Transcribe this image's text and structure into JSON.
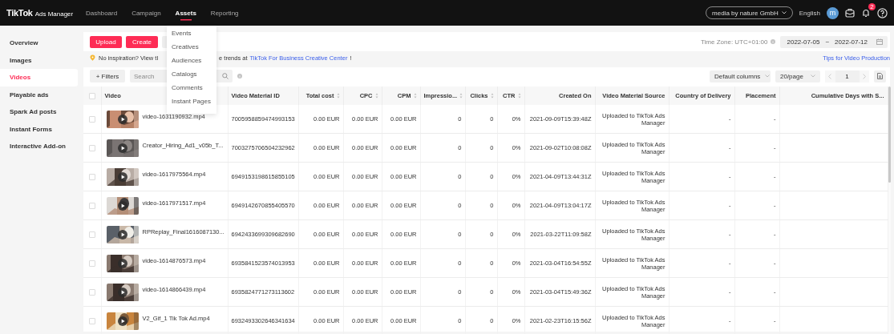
{
  "top_bar": {
    "brand": "TikTok",
    "product": "Ads Manager",
    "nav": [
      {
        "label": "Dashboard",
        "selected": false
      },
      {
        "label": "Campaign",
        "selected": false
      },
      {
        "label": "Assets",
        "selected": true
      },
      {
        "label": "Reporting",
        "selected": false
      }
    ],
    "account": "media by nature GmbH",
    "language": "English",
    "avatar": "m",
    "notifications": "2"
  },
  "assets_menu": [
    "Events",
    "Creatives",
    "Audiences",
    "Catalogs",
    "Comments",
    "Instant Pages"
  ],
  "sidebar": {
    "items": [
      {
        "label": "Overview",
        "selected": false
      },
      {
        "label": "Images",
        "selected": false
      },
      {
        "label": "Videos",
        "selected": true
      },
      {
        "label": "Playable ads",
        "selected": false
      },
      {
        "label": "Spark Ad posts",
        "selected": false
      },
      {
        "label": "Instant Forms",
        "selected": false
      },
      {
        "label": "Interactive Add-on",
        "selected": false
      }
    ]
  },
  "toolbar": {
    "buttons": [
      "Upload",
      "Create"
    ],
    "timezone": "Time Zone: UTC+01:00",
    "date_start": "2022-07-05",
    "date_separator": "~",
    "date_end": "2022-07-12"
  },
  "tip": {
    "text_before": "No inspiration? View tl",
    "text_after": "e trends at",
    "link": "TikTok For Business Creative Center",
    "end": "!",
    "side_link": "Tips for Video Production"
  },
  "filters": {
    "button": "+ Filters",
    "search_placeholder": "Search",
    "columns_select": "Default columns",
    "page_size": "20/page",
    "page": "1"
  },
  "table": {
    "all_checked": false,
    "columns": [
      {
        "label": "Video",
        "sortable": false
      },
      {
        "label": "Video Material ID",
        "sortable": false
      },
      {
        "label": "Total cost",
        "sortable": true
      },
      {
        "label": "CPC",
        "sortable": true
      },
      {
        "label": "CPM",
        "sortable": true
      },
      {
        "label": "Impressio...",
        "sortable": true
      },
      {
        "label": "Clicks",
        "sortable": true
      },
      {
        "label": "CTR",
        "sortable": true
      },
      {
        "label": "Created On",
        "sortable": false
      },
      {
        "label": "Video Material Source",
        "sortable": false
      },
      {
        "label": "Country of Delivery",
        "sortable": false
      },
      {
        "label": "Placement",
        "sortable": false
      },
      {
        "label": "Cumulative Days with S...",
        "sortable": false
      }
    ],
    "rows": [
      {
        "checked": false,
        "cells": [
          "video-1631190932.mp4",
          "7005958859474993153",
          "0.00 EUR",
          "0.00 EUR",
          "0.00 EUR",
          "0",
          "0",
          "0%",
          "2021-09-09T15:39:48Z",
          "Uploaded to TikTok Ads Manager",
          "-",
          "-"
        ]
      },
      {
        "checked": false,
        "cells": [
          "Creator_Hiring_Ad1_v05b_T...",
          "7003275706504232962",
          "0.00 EUR",
          "0.00 EUR",
          "0.00 EUR",
          "0",
          "0",
          "0%",
          "2021-09-02T10:08:08Z",
          "Uploaded to TikTok Ads Manager",
          "-",
          "-"
        ]
      },
      {
        "checked": false,
        "cells": [
          "video-1617975564.mp4",
          "6949153198615855105",
          "0.00 EUR",
          "0.00 EUR",
          "0.00 EUR",
          "0",
          "0",
          "0%",
          "2021-04-09T13:44:31Z",
          "Uploaded to TikTok Ads Manager",
          "-",
          "-"
        ]
      },
      {
        "checked": false,
        "cells": [
          "video-1617971517.mp4",
          "6949142670855405570",
          "0.00 EUR",
          "0.00 EUR",
          "0.00 EUR",
          "0",
          "0",
          "0%",
          "2021-04-09T13:04:17Z",
          "Uploaded to TikTok Ads Manager",
          "-",
          "-"
        ]
      },
      {
        "checked": false,
        "cells": [
          "RPReplay_Final1616087130...",
          "6942433699309682690",
          "0.00 EUR",
          "0.00 EUR",
          "0.00 EUR",
          "0",
          "0",
          "0%",
          "2021-03-22T11:09:58Z",
          "Uploaded to TikTok Ads Manager",
          "-",
          "-"
        ]
      },
      {
        "checked": false,
        "cells": [
          "video-1614876573.mp4",
          "6935841523574013953",
          "0.00 EUR",
          "0.00 EUR",
          "0.00 EUR",
          "0",
          "0",
          "0%",
          "2021-03-04T16:54:55Z",
          "Uploaded to TikTok Ads Manager",
          "-",
          "-"
        ]
      },
      {
        "checked": false,
        "cells": [
          "video-1614866439.mp4",
          "6935824771273113602",
          "0.00 EUR",
          "0.00 EUR",
          "0.00 EUR",
          "0",
          "0",
          "0%",
          "2021-03-04T15:49:36Z",
          "Uploaded to TikTok Ads Manager",
          "-",
          "-"
        ]
      },
      {
        "checked": false,
        "cells": [
          "V2_Gif_1 Tik Tok Ad.mp4",
          "6932493302646341634",
          "0.00 EUR",
          "0.00 EUR",
          "0.00 EUR",
          "0",
          "0",
          "0%",
          "2021-02-23T16:15:56Z",
          "Uploaded to TikTok Ads Manager",
          "-",
          "-"
        ]
      }
    ]
  }
}
